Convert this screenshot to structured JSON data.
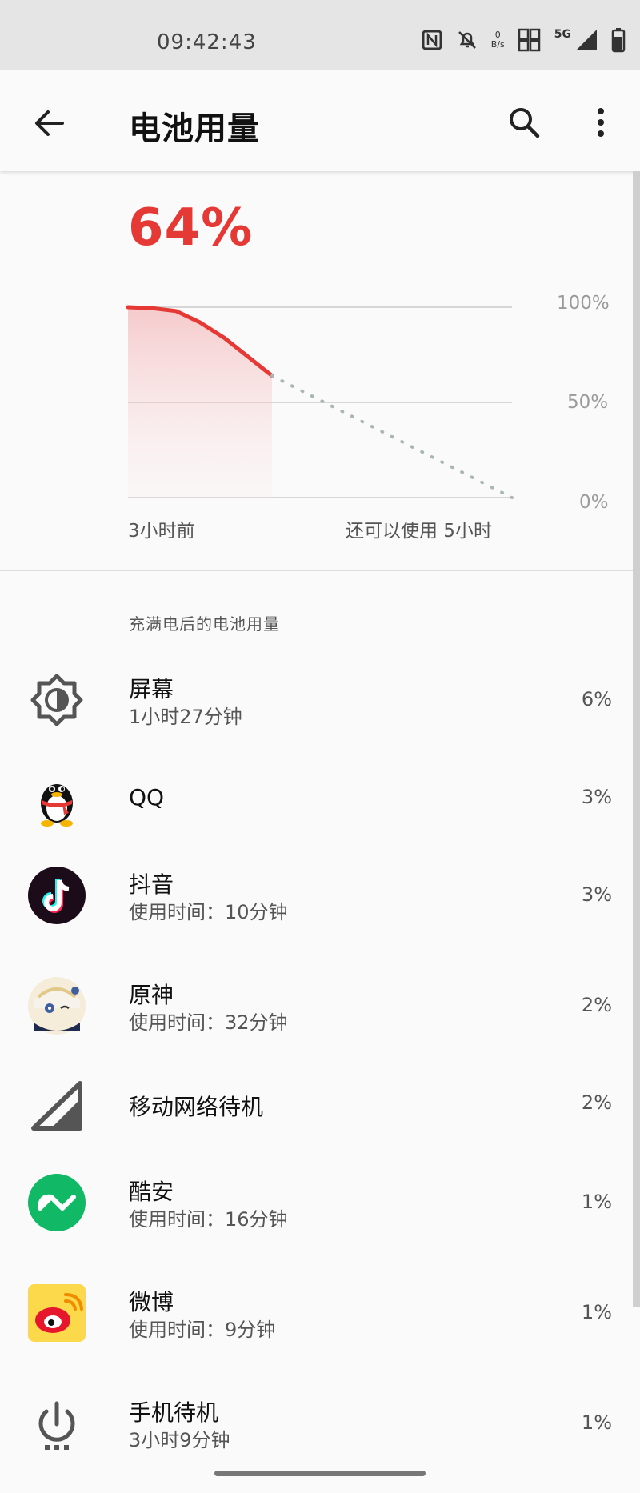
{
  "status_bar": {
    "time": "09:42:43",
    "net_speed_value": "0",
    "net_speed_unit": "B/s",
    "network": "5G"
  },
  "header": {
    "title": "电池用量"
  },
  "battery": {
    "percent": "64%",
    "accent_color": "#e53935",
    "axis_100": "100%",
    "axis_50": "50%",
    "axis_0": "0%",
    "start_label": "3小时前",
    "remaining_label": "还可以使用 5小时"
  },
  "chart_data": {
    "type": "area",
    "history": {
      "x_hours": [
        -3,
        -2.5,
        -2,
        -1.5,
        -1,
        0
      ],
      "level_percent": [
        100,
        99.5,
        98,
        92,
        84,
        64
      ]
    },
    "projection": {
      "x_hours": [
        0,
        5
      ],
      "level_percent": [
        64,
        0
      ]
    },
    "ylim": [
      0,
      100
    ],
    "yticks": [
      "100%",
      "50%",
      "0%"
    ],
    "grid": true
  },
  "section": {
    "title": "充满电后的电池用量"
  },
  "items": [
    {
      "name": "屏幕",
      "detail": "1小时27分钟",
      "value": "6%",
      "icon": "brightness-icon"
    },
    {
      "name": "QQ",
      "detail": "",
      "value": "3%",
      "icon": "qq-icon"
    },
    {
      "name": "抖音",
      "detail": "使用时间：10分钟",
      "value": "3%",
      "icon": "douyin-icon"
    },
    {
      "name": "原神",
      "detail": "使用时间：32分钟",
      "value": "2%",
      "icon": "genshin-icon"
    },
    {
      "name": "移动网络待机",
      "detail": "",
      "value": "2%",
      "icon": "cell-signal-icon"
    },
    {
      "name": "酷安",
      "detail": "使用时间：16分钟",
      "value": "1%",
      "icon": "coolapk-icon"
    },
    {
      "name": "微博",
      "detail": "使用时间：9分钟",
      "value": "1%",
      "icon": "weibo-icon"
    },
    {
      "name": "手机待机",
      "detail": "3小时9分钟",
      "value": "1%",
      "icon": "power-icon"
    }
  ]
}
